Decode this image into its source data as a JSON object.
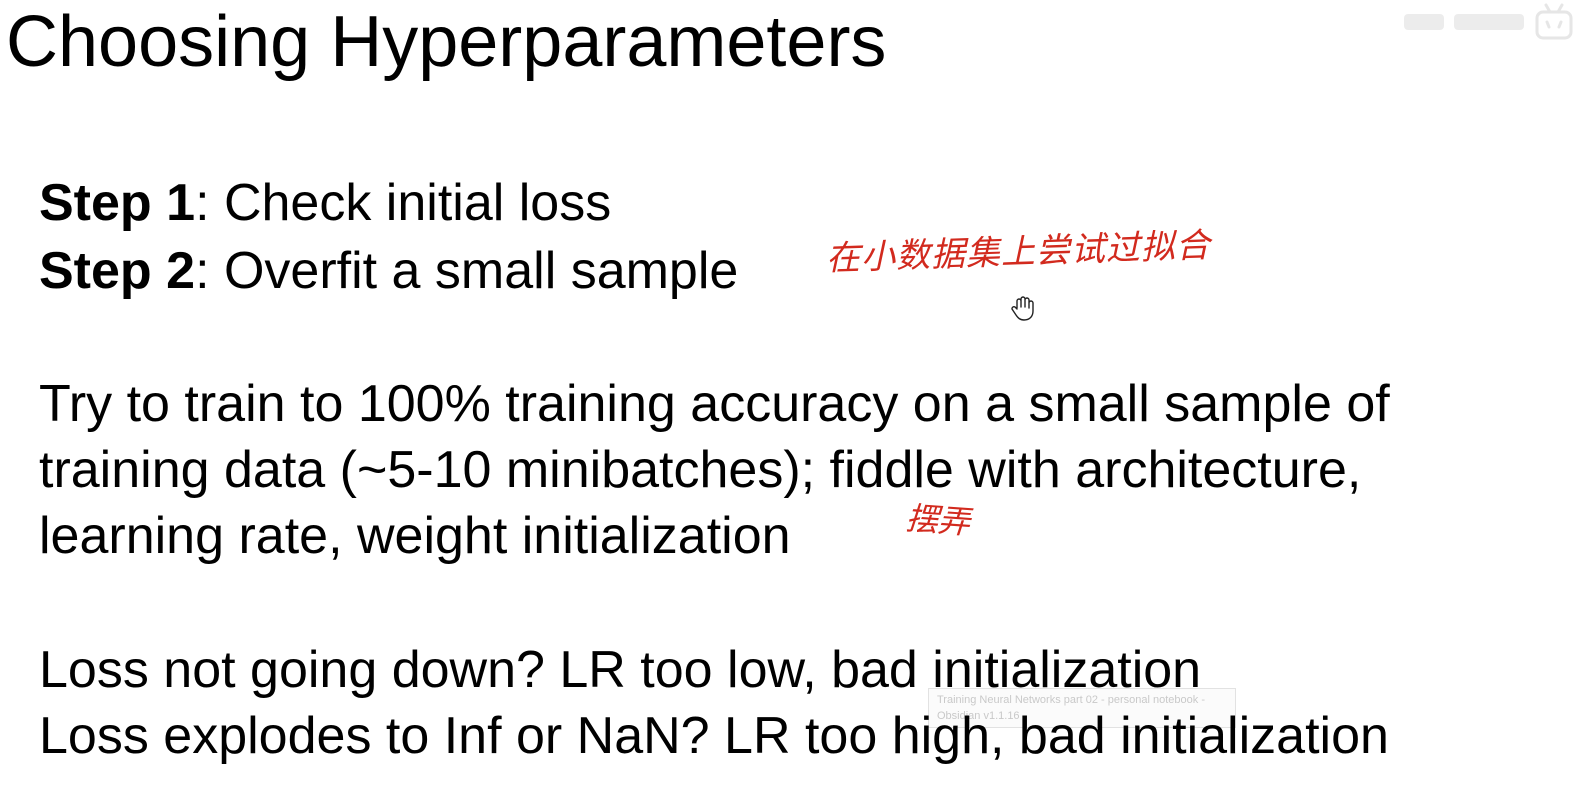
{
  "slide": {
    "title": "Choosing Hyperparameters",
    "step1": {
      "label": "Step 1",
      "text": ": Check initial loss"
    },
    "step2": {
      "label": "Step 2",
      "text": ": Overfit a small sample"
    },
    "paragraph": [
      "Try to train to 100% training accuracy on a small sample of",
      "training data (~5-10 minibatches); fiddle with architecture,",
      "learning rate, weight initialization"
    ],
    "loss_lines": [
      "Loss not going down? LR too low, bad initialization",
      "Loss explodes to Inf or NaN? LR too high, bad initialization"
    ]
  },
  "annotations": {
    "overfit_note": "在小数据集上尝试过拟合",
    "fiddle_note": "摆弄",
    "color": "#d22a1e"
  },
  "cursor": {
    "icon": "hand-grab-icon"
  },
  "watermark": {
    "icon": "bilibili-logo"
  },
  "tooltip": {
    "text": "Training Neural Networks part 02 - personal notebook - Obsidian v1.1.16"
  }
}
